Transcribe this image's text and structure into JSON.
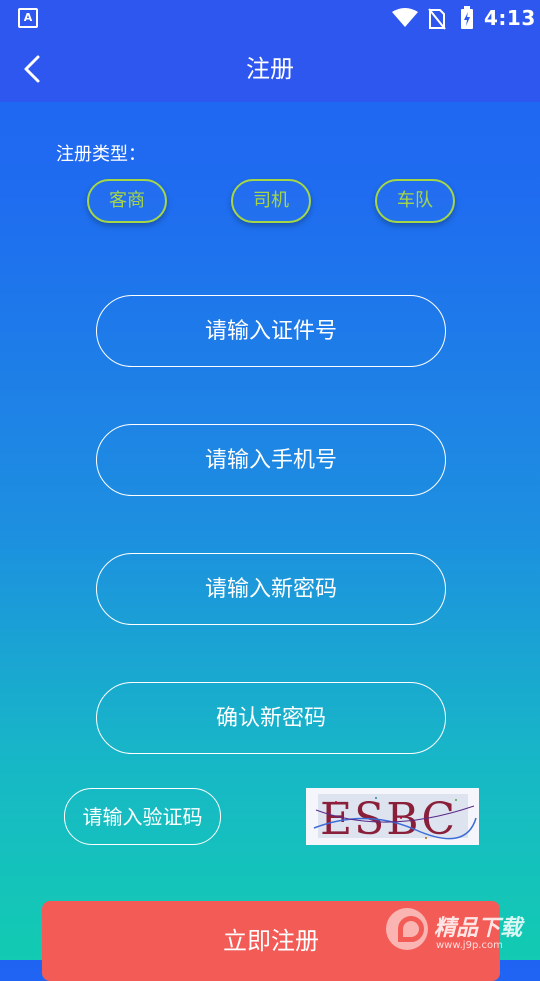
{
  "status_bar": {
    "app_icon_letter": "A",
    "time": "4:13"
  },
  "header": {
    "title": "注册"
  },
  "registration_type": {
    "label": "注册类型：",
    "options": [
      "客商",
      "司机",
      "车队"
    ]
  },
  "form": {
    "id_placeholder": "请输入证件号",
    "phone_placeholder": "请输入手机号",
    "password_placeholder": "请输入新密码",
    "confirm_password_placeholder": "确认新密码",
    "captcha_placeholder": "请输入验证码",
    "captcha_image_text": "ESBC"
  },
  "register_button": {
    "label": "立即注册"
  },
  "watermark": {
    "text": "精品下载",
    "url": "www.j9p.com"
  },
  "colors": {
    "header_bg": "#2e57f0",
    "type_button_accent": "#a5d646",
    "register_button_bg": "#f35b56"
  }
}
